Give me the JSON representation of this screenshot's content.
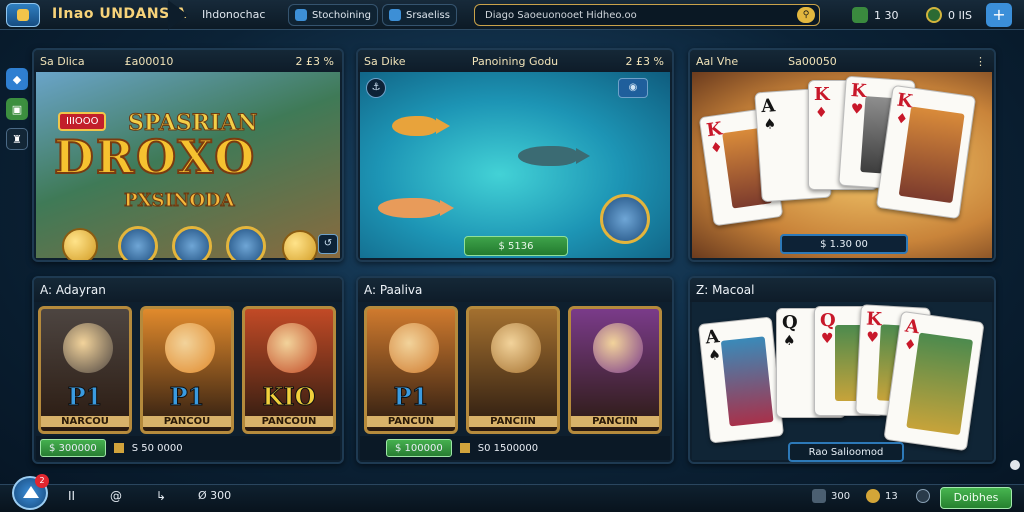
{
  "topbar": {
    "brand": "IInao UNDANSIA",
    "section": "Ihdonochac",
    "pill1": "Stochoining",
    "pill2": "Srsaeliss",
    "search_placeholder": "Diago Saoeuonooet Hidheo.oo",
    "coins": "1 30",
    "gems": "0 IIS",
    "plus": "+"
  },
  "left_rail": {
    "items": [
      "slots-icon",
      "gift-icon",
      "trophy-icon"
    ]
  },
  "cards": {
    "slots": {
      "title": "Sa Dlica",
      "amount": "£a00010",
      "count": "2 £3 %",
      "tag": "IIIOOO",
      "brand": "SPASRIAN",
      "logo": "DROXO",
      "sub": "PXSINODA"
    },
    "fishing": {
      "title": "Sa Dike",
      "heading": "Panoining Godu",
      "count": "2 £3 %",
      "price": "$ 5136"
    },
    "cards": {
      "title": "Aal Vhe",
      "amount": "Sa00050",
      "count": "",
      "price": "$ 1.30 00"
    }
  },
  "bottom_cards": {
    "left": {
      "title": "A: Adayran",
      "tiles": [
        {
          "big": "P1",
          "label": "NARCOU",
          "color": "#4d4541"
        },
        {
          "big": "P1",
          "label": "PANCOU",
          "color": "#e18a2c"
        },
        {
          "big": "KIO",
          "label": "PANCOUN",
          "color": "#c24a26"
        }
      ],
      "bar_btn": "$ 300000",
      "bar_value": "S 50 0000"
    },
    "mid": {
      "title": "A: Paaliva",
      "tiles": [
        {
          "big": "P1",
          "label": "PANCUN",
          "color": "#cf7a2e"
        },
        {
          "big": "",
          "label": "PANCIIN",
          "color": "#a4702f"
        },
        {
          "big": "",
          "label": "PANCIIN",
          "color": "#7a3b8a"
        }
      ],
      "bar_btn": "$ 100000",
      "bar_value": "S0 1500000"
    },
    "right": {
      "title": "Z: Macoal",
      "price": "Rao Salioomod"
    }
  },
  "bottombar": {
    "home_badge": "2",
    "nav1": "II",
    "nav2": "@",
    "nav3": "↳",
    "nav4": "Ø 300",
    "r1": "300",
    "r2": "13",
    "play": "Doibhes"
  }
}
